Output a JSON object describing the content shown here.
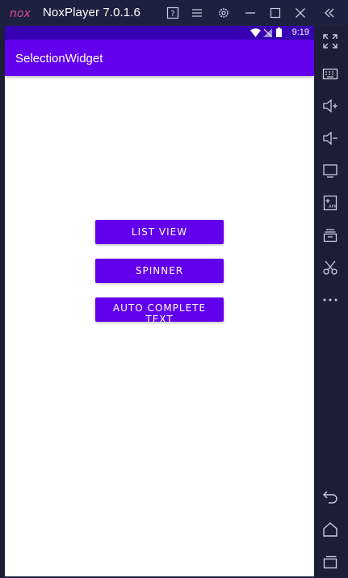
{
  "window": {
    "title": "NoxPlayer 7.0.1.6",
    "logo_text": "nox"
  },
  "statusbar": {
    "time": "9:19"
  },
  "app": {
    "title": "SelectionWidget",
    "buttons": {
      "list_view": "LIST VIEW",
      "spinner": "SPINNER",
      "auto_complete_line1": "AUTO COMPLETE",
      "auto_complete_line2": "TEXT"
    }
  },
  "colors": {
    "primary": "#6200ee",
    "primary_dark": "#3700b3",
    "emulator_frame": "#1b1e36",
    "logo_pink": "#d94a8c"
  },
  "sidebar_icons": [
    "fullscreen-icon",
    "keyboard-icon",
    "volume-up-icon",
    "volume-down-icon",
    "screen-icon",
    "apk-install-icon",
    "multi-instance-icon",
    "scissors-icon",
    "more-icon",
    "back-icon",
    "home-icon",
    "recent-apps-icon"
  ]
}
